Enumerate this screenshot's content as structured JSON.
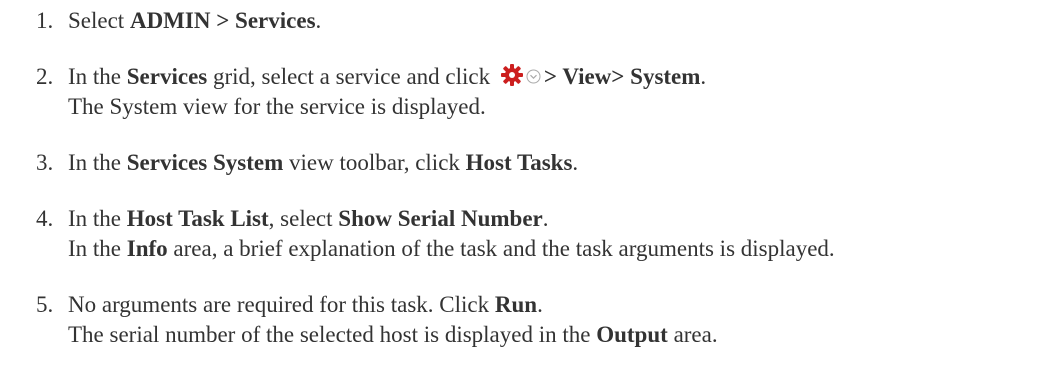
{
  "steps": [
    {
      "number": "1.",
      "line1": {
        "t1": "Select ",
        "b1": "ADMIN > Services",
        "t2": "."
      }
    },
    {
      "number": "2.",
      "line1": {
        "t1": "In the ",
        "b1": "Services",
        "t2": " grid, select a service and click ",
        "b2": "> View> System",
        "t3": "."
      },
      "line2": "The System view for the service is displayed."
    },
    {
      "number": "3.",
      "line1": {
        "t1": "In the ",
        "b1": "Services System",
        "t2": " view toolbar, click ",
        "b2": "Host Tasks",
        "t3": "."
      }
    },
    {
      "number": "4.",
      "line1": {
        "t1": "In the ",
        "b1": "Host Task List",
        "t2": ", select ",
        "b2": "Show Serial Number",
        "t3": "."
      },
      "line2": {
        "t1": "In the ",
        "b1": "Info",
        "t2": " area, a brief explanation of the task and the task arguments is displayed."
      }
    },
    {
      "number": "5.",
      "line1": {
        "t1": "No arguments are required for this task. Click ",
        "b1": "Run",
        "t2": "."
      },
      "line2": {
        "t1": "The serial number of the selected host is displayed in the ",
        "b1": "Output",
        "t2": " area."
      }
    }
  ],
  "icons": {
    "gear": "gear-icon",
    "gear_color": "#cc1f1f",
    "chevron": "chevron-down-circle-icon",
    "chevron_color": "#aaaaaa"
  },
  "colors": {
    "text": "#333333",
    "background": "#ffffff"
  }
}
